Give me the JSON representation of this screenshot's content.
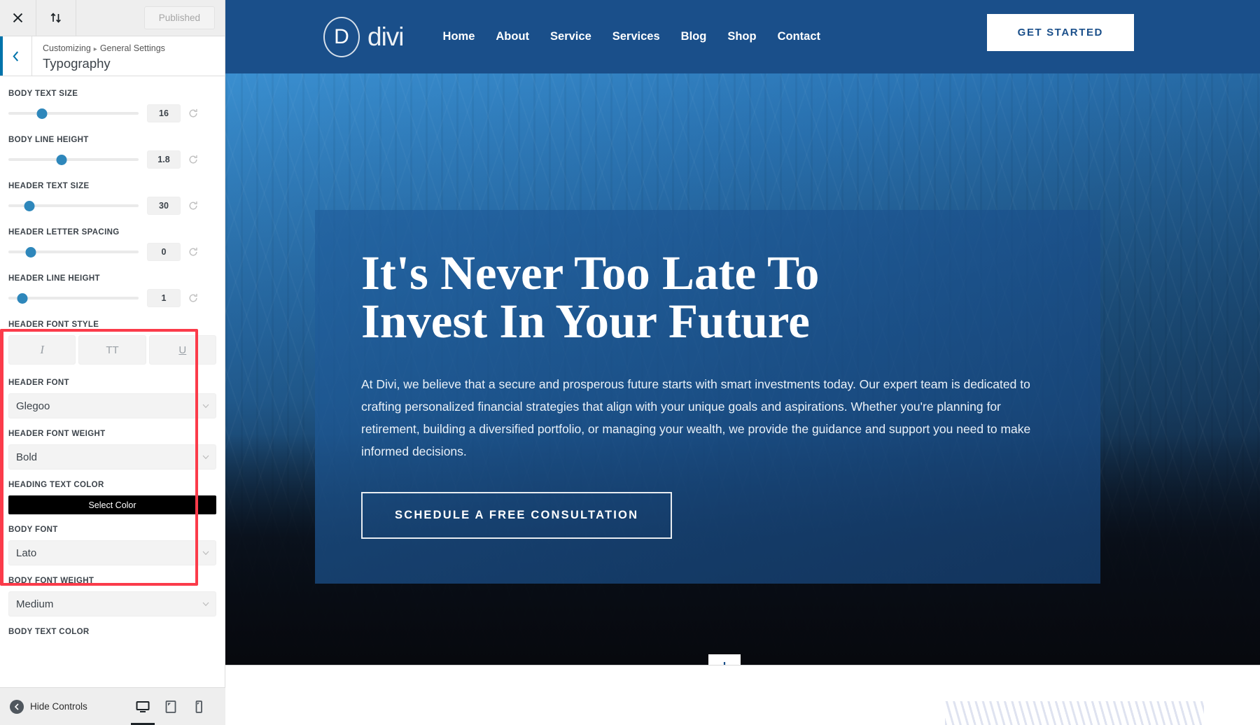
{
  "customizer": {
    "topbar": {
      "close_icon": "close-icon",
      "devices_icon": "sort-arrows-icon",
      "published_label": "Published"
    },
    "header": {
      "back_icon": "chevron-left-icon",
      "breadcrumb_root": "Customizing",
      "breadcrumb_separator": "▸",
      "breadcrumb_parent": "General Settings",
      "section_title": "Typography"
    },
    "sliders": [
      {
        "label": "BODY TEXT SIZE",
        "value": "16",
        "knob_pct": 26,
        "reset_icon": "reset-icon"
      },
      {
        "label": "BODY LINE HEIGHT",
        "value": "1.8",
        "knob_pct": 41,
        "reset_icon": "reset-icon"
      },
      {
        "label": "HEADER TEXT SIZE",
        "value": "30",
        "knob_pct": 16,
        "reset_icon": "reset-icon"
      },
      {
        "label": "HEADER LETTER SPACING",
        "value": "0",
        "knob_pct": 17,
        "reset_icon": "reset-icon"
      },
      {
        "label": "HEADER LINE HEIGHT",
        "value": "1",
        "knob_pct": 11,
        "reset_icon": "reset-icon"
      }
    ],
    "font_style": {
      "label": "HEADER FONT STYLE",
      "buttons": [
        {
          "name": "italic-button",
          "glyph": "I",
          "icon": "italic-icon"
        },
        {
          "name": "uppercase-button",
          "glyph": "TT",
          "icon": "uppercase-icon"
        },
        {
          "name": "underline-button",
          "glyph": "U",
          "icon": "underline-icon"
        }
      ]
    },
    "fields": {
      "header_font": {
        "label": "HEADER FONT",
        "value": "Glegoo"
      },
      "header_font_weight": {
        "label": "HEADER FONT WEIGHT",
        "value": "Bold"
      },
      "heading_text_color": {
        "label": "HEADING TEXT COLOR",
        "button_label": "Select Color",
        "swatch": "#000000"
      },
      "body_font": {
        "label": "BODY FONT",
        "value": "Lato"
      },
      "body_font_weight": {
        "label": "BODY FONT WEIGHT",
        "value": "Medium"
      },
      "body_text_color": {
        "label": "BODY TEXT COLOR"
      }
    },
    "highlight_color": "#fb3b4a",
    "footer": {
      "hide_controls_label": "Hide Controls",
      "hide_controls_icon": "collapse-left-icon",
      "devices": [
        {
          "name": "desktop-preview-button",
          "icon": "desktop-icon",
          "active": true
        },
        {
          "name": "tablet-preview-button",
          "icon": "tablet-icon",
          "active": false
        },
        {
          "name": "mobile-preview-button",
          "icon": "mobile-icon",
          "active": false
        }
      ]
    }
  },
  "preview": {
    "nav": {
      "logo_letter": "D",
      "logo_text": "divi",
      "links": [
        "Home",
        "About",
        "Service",
        "Services",
        "Blog",
        "Shop",
        "Contact"
      ],
      "cta_label": "GET STARTED",
      "bg_color": "#1a4f8a"
    },
    "hero": {
      "heading_line1": "It's Never Too Late To",
      "heading_line2": "Invest In Your Future",
      "paragraph": "At Divi, we believe that a secure and prosperous future starts with smart investments today. Our expert team is dedicated to crafting personalized financial strategies that align with your unique goals and aspirations. Whether you're planning for retirement, building a diversified portfolio, or managing your wealth, we provide the guidance and support you need to make informed decisions.",
      "cta_label": "SCHEDULE A FREE CONSULTATION",
      "scroll_icon": "arrow-down-icon"
    }
  }
}
